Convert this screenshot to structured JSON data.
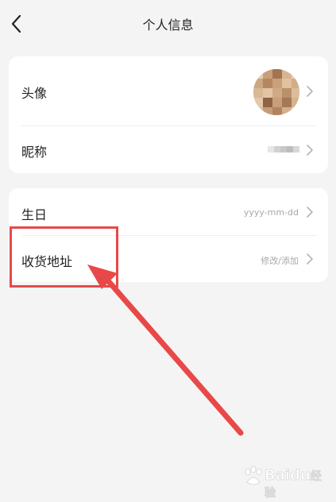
{
  "header": {
    "title": "个人信息"
  },
  "profile_card": {
    "avatar_label": "头像",
    "nickname_label": "昵称"
  },
  "info_card": {
    "birthday_label": "生日",
    "birthday_placeholder": "yyyy-mm-dd",
    "address_label": "收货地址",
    "address_action": "修改/添加"
  },
  "watermark": {
    "text": "Baidu",
    "suffix": "经验"
  },
  "colors": {
    "background": "#f4f4f4",
    "card": "#ffffff",
    "annotation": "#e94848",
    "secondary_text": "#a8a8a8"
  },
  "icons": [
    "back-icon",
    "chevron-right-icon",
    "paw-icon"
  ]
}
